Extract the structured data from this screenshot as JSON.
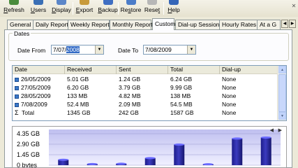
{
  "toolbar": {
    "buttons": [
      {
        "label": "Refresh",
        "ul": "R",
        "rest": "efresh",
        "icon": "refresh-icon",
        "color": "#4a8c3c"
      },
      {
        "label": "Users",
        "ul": "U",
        "rest": "sers",
        "icon": "users-icon",
        "color": "#3a6fb5"
      },
      {
        "label": "Display",
        "ul": "D",
        "rest": "isplay",
        "icon": "display-icon",
        "color": "#5b86c8"
      },
      {
        "label": "Export",
        "ul": "E",
        "rest": "xport",
        "icon": "export-icon",
        "color": "#c89a3a"
      },
      {
        "label": "Backup",
        "ul": "B",
        "rest": "ackup",
        "icon": "backup-icon",
        "color": "#3f6ec2"
      },
      {
        "label": "Restore",
        "pre": "Re",
        "ul": "s",
        "rest": "tore",
        "icon": "restore-icon",
        "color": "#4b7cc8"
      },
      {
        "label": "Reset",
        "pre": "Rese",
        "ul": "t",
        "rest": "",
        "icon": "reset-icon",
        "color": "#b7b7b7"
      },
      {
        "label": "Help",
        "ul": "H",
        "rest": "elp",
        "icon": "help-icon",
        "color": "#3566b8"
      }
    ]
  },
  "tabs": [
    "General",
    "Daily Report",
    "Weekly Report",
    "Monthly Report",
    "Custom",
    "Dial-up Sessions",
    "Hourly Rates",
    "At a G"
  ],
  "active_tab": "Custom",
  "dates": {
    "group_title": "Dates",
    "from_label": "Date From",
    "from_prefix": "7/07/",
    "from_selected": "2008",
    "to_label": "Date To",
    "to_value": "7/08/2009"
  },
  "table": {
    "columns": [
      "Date",
      "Received",
      "Sent",
      "Total",
      "Dial-up"
    ],
    "rows": [
      {
        "date": "26/05/2009",
        "received": "5.01 GB",
        "sent": "1.24 GB",
        "total": "6.24 GB",
        "dialup": "None"
      },
      {
        "date": "27/05/2009",
        "received": "6.20 GB",
        "sent": "3.79 GB",
        "total": "9.99 GB",
        "dialup": "None"
      },
      {
        "date": "28/05/2009",
        "received": "133 MB",
        "sent": "4.82 MB",
        "total": "138 MB",
        "dialup": "None"
      },
      {
        "date": "7/08/2009",
        "received": "52.4 MB",
        "sent": "2.09 MB",
        "total": "54.5 MB",
        "dialup": "None"
      }
    ],
    "total_row": {
      "date": "Total",
      "received": "1345 GB",
      "sent": "242 GB",
      "total": "1587 GB",
      "dialup": "None"
    }
  },
  "chart_data": {
    "type": "bar",
    "y_tick_labels": [
      "4.35 GB",
      "2.90 GB",
      "1.45 GB",
      "0 bytes"
    ],
    "ylim": [
      0,
      4.35
    ],
    "unit": "GB",
    "values": [
      0.75,
      0.16,
      0.2,
      0.98,
      2.85,
      0.13,
      3.68,
      3.82
    ],
    "bar_color": "#3b3bbf",
    "background_top": "#c0c0f0",
    "background_bottom": "#f0f0ff",
    "grid": true
  }
}
